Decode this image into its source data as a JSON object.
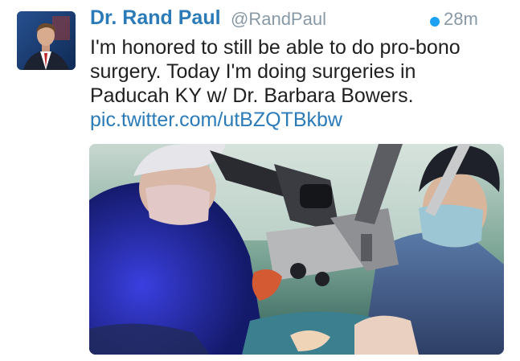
{
  "tweet": {
    "author_name": "Dr. Rand Paul",
    "handle": "@RandPaul",
    "time": "28m",
    "text_lines": [
      "I'm honored to still be able to do pro-bono",
      "surgery. Today I'm doing surgeries in",
      "Paducah KY w/ Dr. Barbara Bowers."
    ],
    "link": "pic.twitter.com/utBZQTBkbw"
  },
  "colors": {
    "name": "#2b7bb9",
    "meta": "#8899a6",
    "text": "#1f1f1f",
    "unread": "#1da1f2"
  },
  "icons": {
    "avatar": "profile-photo",
    "unread": "unread-dot-icon",
    "media": "surgery-photo"
  }
}
